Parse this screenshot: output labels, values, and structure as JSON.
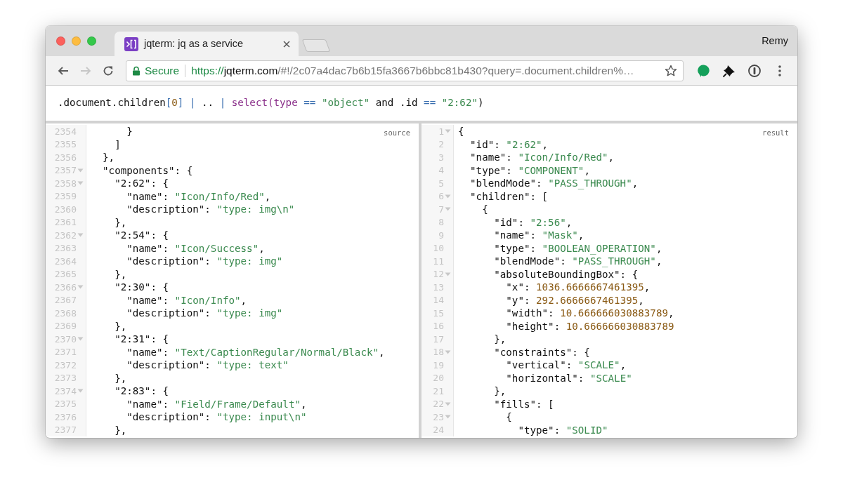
{
  "browser": {
    "window_controls": [
      {
        "kind": "close"
      },
      {
        "kind": "minimize"
      },
      {
        "kind": "zoom"
      }
    ],
    "tabs": [
      {
        "title": "jqterm: jq as a service",
        "selected": true
      }
    ],
    "profile": "Remy",
    "navigation": [
      {
        "kind": "back",
        "disabled": false
      },
      {
        "kind": "forward",
        "disabled": true
      },
      {
        "kind": "reload",
        "disabled": false
      }
    ],
    "address": {
      "security": "Secure",
      "scheme": "https://",
      "host": "jqterm.com",
      "rest": "/#!/2c07a4dac7b6b15fa3667b6bbc81b430?query=.document.children%…"
    }
  },
  "query": [
    {
      "kind": "plain",
      "text": ".document.children"
    },
    {
      "kind": "bracket",
      "text": "["
    },
    {
      "kind": "number",
      "text": "0"
    },
    {
      "kind": "bracket",
      "text": "]"
    },
    {
      "kind": "operator",
      "text": " | "
    },
    {
      "kind": "plain",
      "text": ".."
    },
    {
      "kind": "operator",
      "text": " | "
    },
    {
      "kind": "keyword",
      "text": "select(type"
    },
    {
      "kind": "operator",
      "text": " == "
    },
    {
      "kind": "string",
      "text": "\"object\""
    },
    {
      "kind": "plain",
      "text": " and .id"
    },
    {
      "kind": "operator",
      "text": " == "
    },
    {
      "kind": "string",
      "text": "\"2:62\""
    },
    {
      "kind": "plain",
      "text": ")"
    }
  ],
  "panes": [
    {
      "label": "source",
      "lines": [
        {
          "number": "2354",
          "fold": false,
          "segments": [
            {
              "kind": "plain",
              "text": "      }"
            }
          ]
        },
        {
          "number": "2355",
          "fold": false,
          "segments": [
            {
              "kind": "plain",
              "text": "    ]"
            }
          ]
        },
        {
          "number": "2356",
          "fold": false,
          "segments": [
            {
              "kind": "plain",
              "text": "  },"
            }
          ]
        },
        {
          "number": "2357",
          "fold": true,
          "segments": [
            {
              "kind": "plain",
              "text": "  \"components\": {"
            }
          ]
        },
        {
          "number": "2358",
          "fold": true,
          "segments": [
            {
              "kind": "plain",
              "text": "    \"2:62\": {"
            }
          ]
        },
        {
          "number": "2359",
          "fold": false,
          "segments": [
            {
              "kind": "plain",
              "text": "      \"name\": "
            },
            {
              "kind": "string",
              "text": "\"Icon/Info/Red\""
            },
            {
              "kind": "plain",
              "text": ","
            }
          ]
        },
        {
          "number": "2360",
          "fold": false,
          "segments": [
            {
              "kind": "plain",
              "text": "      \"description\": "
            },
            {
              "kind": "string",
              "text": "\"type: img\\n\""
            }
          ]
        },
        {
          "number": "2361",
          "fold": false,
          "segments": [
            {
              "kind": "plain",
              "text": "    },"
            }
          ]
        },
        {
          "number": "2362",
          "fold": true,
          "segments": [
            {
              "kind": "plain",
              "text": "    \"2:54\": {"
            }
          ]
        },
        {
          "number": "2363",
          "fold": false,
          "segments": [
            {
              "kind": "plain",
              "text": "      \"name\": "
            },
            {
              "kind": "string",
              "text": "\"Icon/Success\""
            },
            {
              "kind": "plain",
              "text": ","
            }
          ]
        },
        {
          "number": "2364",
          "fold": false,
          "segments": [
            {
              "kind": "plain",
              "text": "      \"description\": "
            },
            {
              "kind": "string",
              "text": "\"type: img\""
            }
          ]
        },
        {
          "number": "2365",
          "fold": false,
          "segments": [
            {
              "kind": "plain",
              "text": "    },"
            }
          ]
        },
        {
          "number": "2366",
          "fold": true,
          "segments": [
            {
              "kind": "plain",
              "text": "    \"2:30\": {"
            }
          ]
        },
        {
          "number": "2367",
          "fold": false,
          "segments": [
            {
              "kind": "plain",
              "text": "      \"name\": "
            },
            {
              "kind": "string",
              "text": "\"Icon/Info\""
            },
            {
              "kind": "plain",
              "text": ","
            }
          ]
        },
        {
          "number": "2368",
          "fold": false,
          "segments": [
            {
              "kind": "plain",
              "text": "      \"description\": "
            },
            {
              "kind": "string",
              "text": "\"type: img\""
            }
          ]
        },
        {
          "number": "2369",
          "fold": false,
          "segments": [
            {
              "kind": "plain",
              "text": "    },"
            }
          ]
        },
        {
          "number": "2370",
          "fold": true,
          "segments": [
            {
              "kind": "plain",
              "text": "    \"2:31\": {"
            }
          ]
        },
        {
          "number": "2371",
          "fold": false,
          "segments": [
            {
              "kind": "plain",
              "text": "      \"name\": "
            },
            {
              "kind": "string",
              "text": "\"Text/CaptionRegular/Normal/Black\""
            },
            {
              "kind": "plain",
              "text": ","
            }
          ]
        },
        {
          "number": "2372",
          "fold": false,
          "segments": [
            {
              "kind": "plain",
              "text": "      \"description\": "
            },
            {
              "kind": "string",
              "text": "\"type: text\""
            }
          ]
        },
        {
          "number": "2373",
          "fold": false,
          "segments": [
            {
              "kind": "plain",
              "text": "    },"
            }
          ]
        },
        {
          "number": "2374",
          "fold": true,
          "segments": [
            {
              "kind": "plain",
              "text": "    \"2:83\": {"
            }
          ]
        },
        {
          "number": "2375",
          "fold": false,
          "segments": [
            {
              "kind": "plain",
              "text": "      \"name\": "
            },
            {
              "kind": "string",
              "text": "\"Field/Frame/Default\""
            },
            {
              "kind": "plain",
              "text": ","
            }
          ]
        },
        {
          "number": "2376",
          "fold": false,
          "segments": [
            {
              "kind": "plain",
              "text": "      \"description\": "
            },
            {
              "kind": "string",
              "text": "\"type: input\\n\""
            }
          ]
        },
        {
          "number": "2377",
          "fold": false,
          "segments": [
            {
              "kind": "plain",
              "text": "    },"
            }
          ]
        }
      ]
    },
    {
      "label": "result",
      "lines": [
        {
          "number": "1",
          "fold": true,
          "segments": [
            {
              "kind": "plain",
              "text": "{"
            }
          ]
        },
        {
          "number": "2",
          "fold": false,
          "segments": [
            {
              "kind": "plain",
              "text": "  \"id\": "
            },
            {
              "kind": "string",
              "text": "\"2:62\""
            },
            {
              "kind": "plain",
              "text": ","
            }
          ]
        },
        {
          "number": "3",
          "fold": false,
          "segments": [
            {
              "kind": "plain",
              "text": "  \"name\": "
            },
            {
              "kind": "string",
              "text": "\"Icon/Info/Red\""
            },
            {
              "kind": "plain",
              "text": ","
            }
          ]
        },
        {
          "number": "4",
          "fold": false,
          "segments": [
            {
              "kind": "plain",
              "text": "  \"type\": "
            },
            {
              "kind": "string",
              "text": "\"COMPONENT\""
            },
            {
              "kind": "plain",
              "text": ","
            }
          ]
        },
        {
          "number": "5",
          "fold": false,
          "segments": [
            {
              "kind": "plain",
              "text": "  \"blendMode\": "
            },
            {
              "kind": "string",
              "text": "\"PASS_THROUGH\""
            },
            {
              "kind": "plain",
              "text": ","
            }
          ]
        },
        {
          "number": "6",
          "fold": true,
          "segments": [
            {
              "kind": "plain",
              "text": "  \"children\": ["
            }
          ]
        },
        {
          "number": "7",
          "fold": true,
          "segments": [
            {
              "kind": "plain",
              "text": "    {"
            }
          ]
        },
        {
          "number": "8",
          "fold": false,
          "segments": [
            {
              "kind": "plain",
              "text": "      \"id\": "
            },
            {
              "kind": "string",
              "text": "\"2:56\""
            },
            {
              "kind": "plain",
              "text": ","
            }
          ]
        },
        {
          "number": "9",
          "fold": false,
          "segments": [
            {
              "kind": "plain",
              "text": "      \"name\": "
            },
            {
              "kind": "string",
              "text": "\"Mask\""
            },
            {
              "kind": "plain",
              "text": ","
            }
          ]
        },
        {
          "number": "10",
          "fold": false,
          "segments": [
            {
              "kind": "plain",
              "text": "      \"type\": "
            },
            {
              "kind": "string",
              "text": "\"BOOLEAN_OPERATION\""
            },
            {
              "kind": "plain",
              "text": ","
            }
          ]
        },
        {
          "number": "11",
          "fold": false,
          "segments": [
            {
              "kind": "plain",
              "text": "      \"blendMode\": "
            },
            {
              "kind": "string",
              "text": "\"PASS_THROUGH\""
            },
            {
              "kind": "plain",
              "text": ","
            }
          ]
        },
        {
          "number": "12",
          "fold": true,
          "segments": [
            {
              "kind": "plain",
              "text": "      \"absoluteBoundingBox\": {"
            }
          ]
        },
        {
          "number": "13",
          "fold": false,
          "segments": [
            {
              "kind": "plain",
              "text": "        \"x\": "
            },
            {
              "kind": "number",
              "text": "1036.6666667461395"
            },
            {
              "kind": "plain",
              "text": ","
            }
          ]
        },
        {
          "number": "14",
          "fold": false,
          "segments": [
            {
              "kind": "plain",
              "text": "        \"y\": "
            },
            {
              "kind": "number",
              "text": "292.6666667461395"
            },
            {
              "kind": "plain",
              "text": ","
            }
          ]
        },
        {
          "number": "15",
          "fold": false,
          "segments": [
            {
              "kind": "plain",
              "text": "        \"width\": "
            },
            {
              "kind": "number",
              "text": "10.666666030883789"
            },
            {
              "kind": "plain",
              "text": ","
            }
          ]
        },
        {
          "number": "16",
          "fold": false,
          "segments": [
            {
              "kind": "plain",
              "text": "        \"height\": "
            },
            {
              "kind": "number",
              "text": "10.666666030883789"
            }
          ]
        },
        {
          "number": "17",
          "fold": false,
          "segments": [
            {
              "kind": "plain",
              "text": "      },"
            }
          ]
        },
        {
          "number": "18",
          "fold": true,
          "segments": [
            {
              "kind": "plain",
              "text": "      \"constraints\": {"
            }
          ]
        },
        {
          "number": "19",
          "fold": false,
          "segments": [
            {
              "kind": "plain",
              "text": "        \"vertical\": "
            },
            {
              "kind": "string",
              "text": "\"SCALE\""
            },
            {
              "kind": "plain",
              "text": ","
            }
          ]
        },
        {
          "number": "20",
          "fold": false,
          "segments": [
            {
              "kind": "plain",
              "text": "        \"horizontal\": "
            },
            {
              "kind": "string",
              "text": "\"SCALE\""
            }
          ]
        },
        {
          "number": "21",
          "fold": false,
          "segments": [
            {
              "kind": "plain",
              "text": "      },"
            }
          ]
        },
        {
          "number": "22",
          "fold": true,
          "segments": [
            {
              "kind": "plain",
              "text": "      \"fills\": ["
            }
          ]
        },
        {
          "number": "23",
          "fold": true,
          "segments": [
            {
              "kind": "plain",
              "text": "        {"
            }
          ]
        },
        {
          "number": "24",
          "fold": false,
          "segments": [
            {
              "kind": "plain",
              "text": "          \"type\": "
            },
            {
              "kind": "string",
              "text": "\"SOLID\""
            }
          ]
        }
      ]
    }
  ]
}
